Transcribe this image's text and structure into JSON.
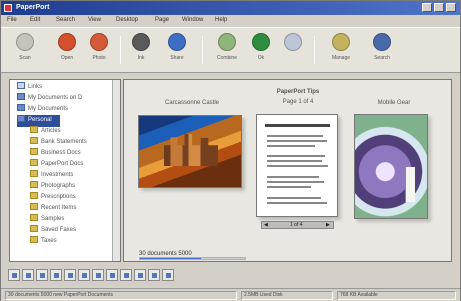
{
  "window": {
    "title": "PaperPort",
    "controls": [
      "minimize-icon",
      "maximize-icon",
      "close-icon"
    ]
  },
  "menu": [
    "File",
    "Edit",
    "Search",
    "View",
    "Desktop",
    "Page",
    "Window",
    "Help"
  ],
  "toolbar": [
    {
      "label": "Scan",
      "icon": "scan-icon",
      "color": "#c4c2bb"
    },
    {
      "label": "Open",
      "icon": "open-icon",
      "color": "#d4502c"
    },
    {
      "label": "Photo",
      "icon": "photo-icon",
      "color": "#d45a3a"
    },
    {
      "label": "Ink",
      "icon": "ink-icon",
      "color": "#5a5a5a"
    },
    {
      "label": "Share",
      "icon": "share-icon",
      "color": "#3d6ec4"
    },
    {
      "label": "Combine",
      "icon": "combine-icon",
      "color": "#8fb57a"
    },
    {
      "label": "Ok",
      "icon": "check-icon",
      "color": "#2f8d40"
    },
    {
      "label": "",
      "icon": "page-icon",
      "color": "#bcc6d6"
    },
    {
      "label": "Manage",
      "icon": "manage-icon",
      "color": "#c3b25e"
    },
    {
      "label": "Search",
      "icon": "search-icon",
      "color": "#486aa9"
    }
  ],
  "folders": [
    {
      "label": "Links",
      "icon": "pc",
      "selected": false
    },
    {
      "label": "My Documents on D",
      "icon": "blue",
      "selected": false
    },
    {
      "label": "My Documents",
      "icon": "blue",
      "selected": false
    },
    {
      "label": "Personal",
      "icon": "folder",
      "selected": true
    },
    {
      "label": "Articles",
      "icon": "folder",
      "selected": false
    },
    {
      "label": "Bank Statements",
      "icon": "folder",
      "selected": false
    },
    {
      "label": "Business Docs",
      "icon": "folder",
      "selected": false
    },
    {
      "label": "PaperPort Docs",
      "icon": "folder",
      "selected": false
    },
    {
      "label": "Investments",
      "icon": "folder",
      "selected": false
    },
    {
      "label": "Photographs",
      "icon": "folder",
      "selected": false
    },
    {
      "label": "Prescriptions",
      "icon": "folder",
      "selected": false
    },
    {
      "label": "Recent Items",
      "icon": "folder",
      "selected": false
    },
    {
      "label": "Samples",
      "icon": "folder",
      "selected": false
    },
    {
      "label": "Saved Faxes",
      "icon": "folder",
      "selected": false
    },
    {
      "label": "Taxes",
      "icon": "folder",
      "selected": false
    }
  ],
  "content": {
    "items": [
      {
        "title": "Carcassonne Castle"
      },
      {
        "title": "PaperPort Tips",
        "subtitle": "Page 1 of 4"
      },
      {
        "title": "Mobile Gear"
      }
    ],
    "doc_nav": {
      "prev": "◀",
      "next": "▶",
      "page": "1 of 4"
    },
    "bottom_label": "30 documents 5000",
    "progress": 0.58
  },
  "bottom_toolbar": [
    "list-icon",
    "grid-icon",
    "thumb-icon",
    "scan-icon",
    "copy-icon",
    "move-icon",
    "rotate-icon",
    "fit-icon",
    "zoom-in-icon",
    "zoom-out-icon",
    "delete-icon",
    "properties-icon"
  ],
  "status": [
    "30 documents 5000 new PaperPort Documents",
    "2.5MB Used Disk",
    "768 KB Available"
  ]
}
